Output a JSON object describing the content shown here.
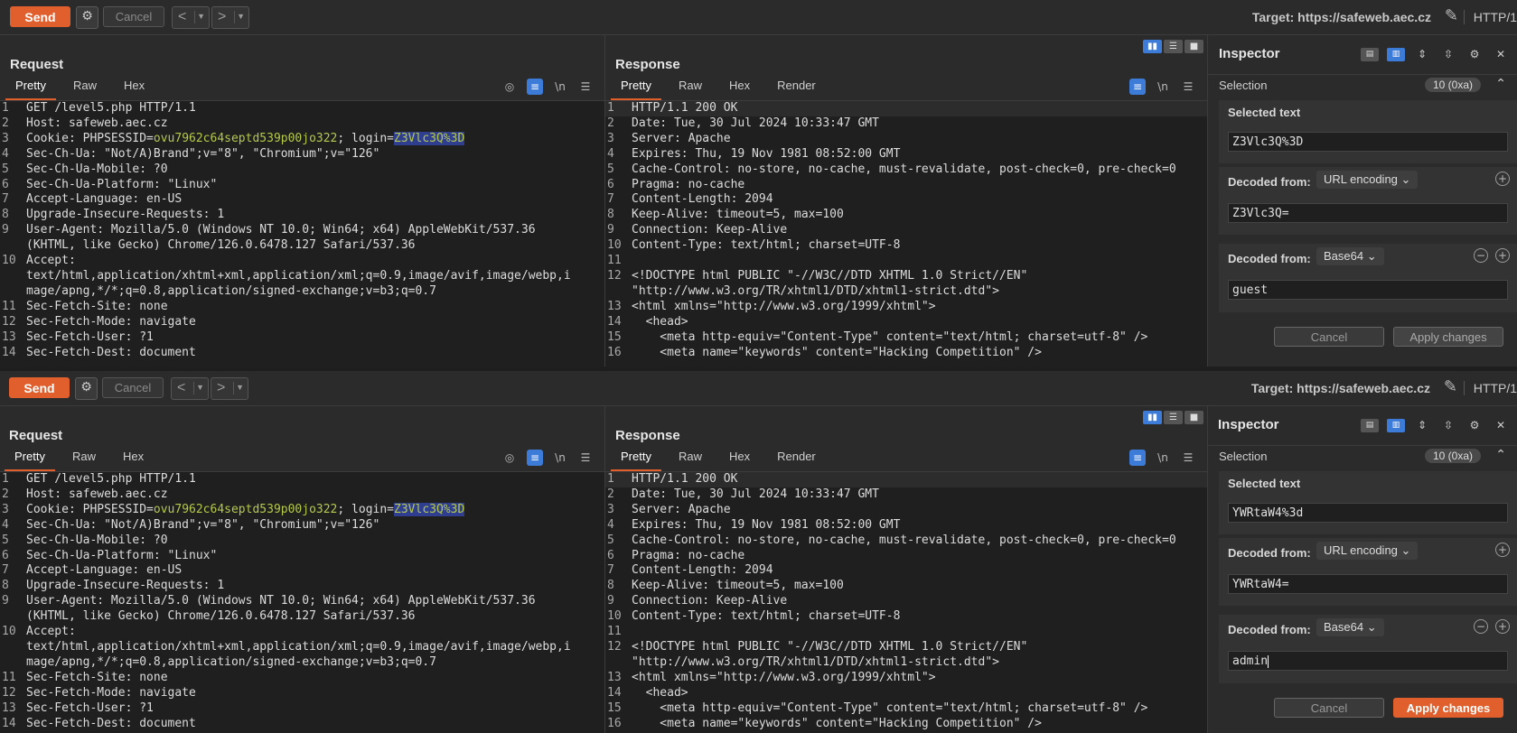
{
  "toolbar": {
    "send_label": "Send",
    "cancel_label": "Cancel",
    "prev_label": "<",
    "next_label": ">",
    "target_label": "Target: https://safeweb.aec.cz",
    "http_label": "HTTP/1"
  },
  "request": {
    "title": "Request",
    "tabs": [
      "Pretty",
      "Raw",
      "Hex"
    ],
    "lines": [
      {
        "n": "1",
        "text": "GET /level5.php HTTP/1.1"
      },
      {
        "n": "2",
        "text": "Host: safeweb.aec.cz"
      },
      {
        "n": "3",
        "pre": "Cookie: PHPSESSID=",
        "val": "ovu7962c64septd539p00jo322",
        "mid": "; login=",
        "sel": "Z3Vlc3Q%3D"
      },
      {
        "n": "4",
        "text": "Sec-Ch-Ua: \"Not/A)Brand\";v=\"8\", \"Chromium\";v=\"126\""
      },
      {
        "n": "5",
        "text": "Sec-Ch-Ua-Mobile: ?0"
      },
      {
        "n": "6",
        "text": "Sec-Ch-Ua-Platform: \"Linux\""
      },
      {
        "n": "7",
        "text": "Accept-Language: en-US"
      },
      {
        "n": "8",
        "text": "Upgrade-Insecure-Requests: 1"
      },
      {
        "n": "9",
        "text": "User-Agent: Mozilla/5.0 (Windows NT 10.0; Win64; x64) AppleWebKit/537.36"
      },
      {
        "n": "",
        "text": "(KHTML, like Gecko) Chrome/126.0.6478.127 Safari/537.36"
      },
      {
        "n": "10",
        "text": "Accept:"
      },
      {
        "n": "",
        "text": "text/html,application/xhtml+xml,application/xml;q=0.9,image/avif,image/webp,i"
      },
      {
        "n": "",
        "text": "mage/apng,*/*;q=0.8,application/signed-exchange;v=b3;q=0.7"
      },
      {
        "n": "11",
        "text": "Sec-Fetch-Site: none"
      },
      {
        "n": "12",
        "text": "Sec-Fetch-Mode: navigate"
      },
      {
        "n": "13",
        "text": "Sec-Fetch-User: ?1"
      },
      {
        "n": "14",
        "text": "Sec-Fetch-Dest: document"
      }
    ]
  },
  "response": {
    "title": "Response",
    "tabs": [
      "Pretty",
      "Raw",
      "Hex",
      "Render"
    ],
    "lines": [
      {
        "n": "1",
        "text": "HTTP/1.1 200 OK"
      },
      {
        "n": "2",
        "text": "Date: Tue, 30 Jul 2024 10:33:47 GMT"
      },
      {
        "n": "3",
        "text": "Server: Apache"
      },
      {
        "n": "4",
        "text": "Expires: Thu, 19 Nov 1981 08:52:00 GMT"
      },
      {
        "n": "5",
        "text": "Cache-Control: no-store, no-cache, must-revalidate, post-check=0, pre-check=0"
      },
      {
        "n": "6",
        "text": "Pragma: no-cache"
      },
      {
        "n": "7",
        "text": "Content-Length: 2094"
      },
      {
        "n": "8",
        "text": "Keep-Alive: timeout=5, max=100"
      },
      {
        "n": "9",
        "text": "Connection: Keep-Alive"
      },
      {
        "n": "10",
        "text": "Content-Type: text/html; charset=UTF-8"
      },
      {
        "n": "11",
        "text": ""
      },
      {
        "n": "12",
        "text": "<!DOCTYPE html PUBLIC \"-//W3C//DTD XHTML 1.0 Strict//EN\""
      },
      {
        "n": "",
        "text": "\"http://www.w3.org/TR/xhtml1/DTD/xhtml1-strict.dtd\">"
      },
      {
        "n": "13",
        "text": "<html xmlns=\"http://www.w3.org/1999/xhtml\">"
      },
      {
        "n": "14",
        "text": "  <head>"
      },
      {
        "n": "15",
        "text": "    <meta http-equiv=\"Content-Type\" content=\"text/html; charset=utf-8\" />"
      },
      {
        "n": "16",
        "text": "    <meta name=\"keywords\" content=\"Hacking Competition\" />"
      }
    ]
  },
  "inspector": {
    "title": "Inspector",
    "selection_label": "Selection",
    "selection_badge": "10 (0xa)",
    "selected_text_label": "Selected text",
    "decoded_from_label": "Decoded from:",
    "url_encoding": "URL encoding",
    "base64": "Base64",
    "cancel_label": "Cancel",
    "apply_label": "Apply changes"
  },
  "top": {
    "selected_text": "Z3Vlc3Q%3D",
    "url_decoded": "Z3Vlc3Q=",
    "base64_decoded": "guest"
  },
  "bottom": {
    "selected_text": "YWRtaW4%3d",
    "url_decoded": "YWRtaW4=",
    "base64_decoded": "admin"
  }
}
